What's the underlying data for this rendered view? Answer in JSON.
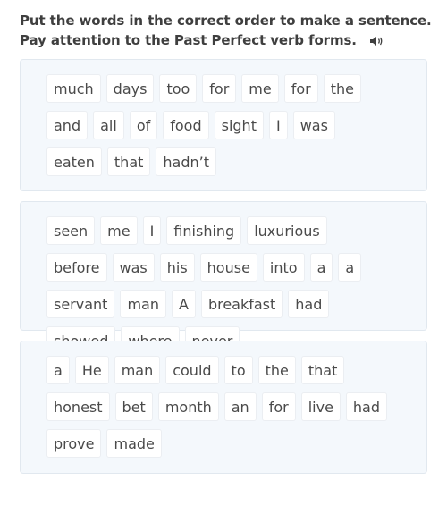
{
  "instructions": {
    "line1": "Put the words in the correct order to make a sentence.",
    "line2": "Pay attention to the Past Perfect verb forms.",
    "audio_icon": "speaker-icon"
  },
  "exercises": [
    {
      "words": [
        "much",
        "days",
        "too",
        "for",
        "me",
        "for",
        "the",
        "and",
        "all",
        "of",
        "food",
        "sight",
        "I",
        "was",
        "eaten",
        "that",
        "hadn’t"
      ]
    },
    {
      "words": [
        "seen",
        "me",
        "I",
        "finishing",
        "luxurious",
        "before",
        "was",
        "his",
        "house",
        "into",
        "a",
        "a",
        "servant",
        "man",
        "A",
        "breakfast",
        "had",
        "showed",
        "where",
        "never"
      ]
    },
    {
      "words": [
        "a",
        "He",
        "man",
        "could",
        "to",
        "the",
        "that",
        "honest",
        "bet",
        "month",
        "an",
        "for",
        "live",
        "had",
        "prove",
        "made"
      ]
    }
  ],
  "colors": {
    "panel_bg": "#f4f8fc",
    "tile_bg": "#ffffff",
    "text": "#3f3f3f"
  }
}
